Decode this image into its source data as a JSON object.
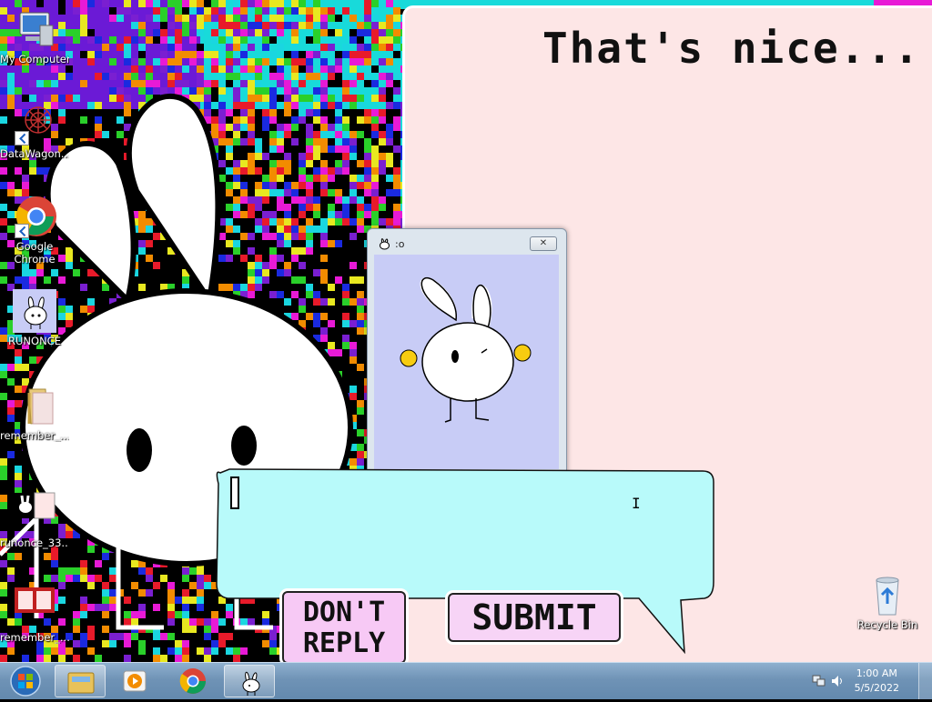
{
  "desktop": {
    "icons": [
      {
        "label": "My Computer",
        "icon": "computer-icon"
      },
      {
        "label": "DataWagon...",
        "icon": "spider-web-icon"
      },
      {
        "label": "Google Chrome",
        "icon": "chrome-icon"
      },
      {
        "label": "RUNONCE",
        "icon": "bunny-app-icon"
      },
      {
        "label": "remember_...",
        "icon": "folder-icon"
      },
      {
        "label": "runonce_33...",
        "icon": "image-file-icon"
      },
      {
        "label": "remember_...",
        "icon": "image-file-icon"
      },
      {
        "label": "Recycle Bin",
        "icon": "recycle-bin-icon"
      }
    ]
  },
  "note": {
    "title": "That's nice..."
  },
  "mini_window": {
    "title": ":o",
    "close_label": "✕"
  },
  "reply": {
    "value": "",
    "cursor_glyph": "I"
  },
  "buttons": {
    "dont_reply_line1": "DON'T",
    "dont_reply_line2": "REPLY",
    "submit": "SUBMIT"
  },
  "taskbar": {
    "apps": [
      "windows-start-icon",
      "file-explorer-icon",
      "media-player-icon",
      "chrome-icon",
      "bunny-app-icon"
    ],
    "time": "1:00 AM",
    "date": "5/5/2022"
  },
  "colors": {
    "note_bg": "#fde6e6",
    "bubble": "#b8fafa",
    "button": "#f7c9f5",
    "mini_window_bg": "#c8ccf6"
  }
}
